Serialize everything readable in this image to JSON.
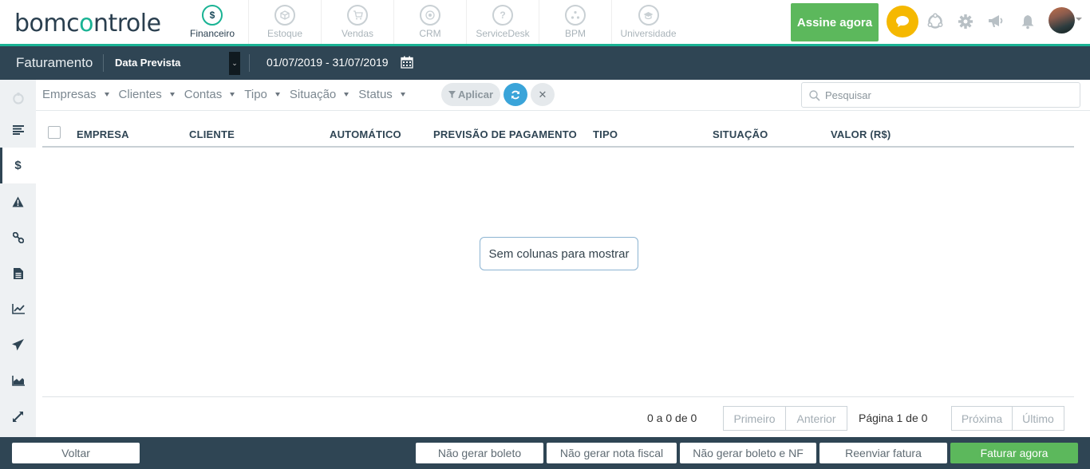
{
  "brand": {
    "logo_prefix": "bomc",
    "logo_o": "o",
    "logo_suffix": "ntrole"
  },
  "modules": [
    {
      "label": "Financeiro",
      "icon": "$",
      "active": true
    },
    {
      "label": "Estoque",
      "icon": "box"
    },
    {
      "label": "Vendas",
      "icon": "cart"
    },
    {
      "label": "CRM",
      "icon": "target"
    },
    {
      "label": "ServiceDesk",
      "icon": "?"
    },
    {
      "label": "BPM",
      "icon": "cycle"
    },
    {
      "label": "Universidade",
      "icon": "cap"
    }
  ],
  "header": {
    "cta": "Assine agora",
    "icons": [
      "chat-icon",
      "support-icon",
      "gear-icon",
      "megaphone-icon",
      "bell-icon"
    ]
  },
  "subbar": {
    "title": "Faturamento",
    "date_filter": "Data Prevista",
    "date_range": "01/07/2019 - 31/07/2019"
  },
  "filters": {
    "dropdowns": [
      "Empresas",
      "Clientes",
      "Contas",
      "Tipo",
      "Situação",
      "Status"
    ],
    "apply": "Aplicar",
    "search_placeholder": "Pesquisar"
  },
  "table": {
    "columns": [
      "EMPRESA",
      "CLIENTE",
      "AUTOMÁTICO",
      "PREVISÃO DE PAGAMENTO",
      "TIPO",
      "SITUAÇÃO",
      "VALOR (R$)"
    ],
    "rows": [],
    "empty_message": "Sem colunas para mostrar"
  },
  "pagination": {
    "count": "0 a 0 de 0",
    "first": "Primeiro",
    "previous": "Anterior",
    "page_info": "Página 1 de 0",
    "next": "Próxima",
    "last": "Último"
  },
  "footer": {
    "back": "Voltar",
    "no_boleto": "Não gerar boleto",
    "no_nf": "Não gerar nota fiscal",
    "no_boleto_nf": "Não gerar boleto e NF",
    "resend": "Reenviar fatura",
    "bill_now": "Faturar agora"
  },
  "colors": {
    "accent": "#1ab394",
    "navy": "#2f4554",
    "success": "#5cb85c",
    "chat": "#f5b800",
    "refresh": "#3aa4d9"
  }
}
